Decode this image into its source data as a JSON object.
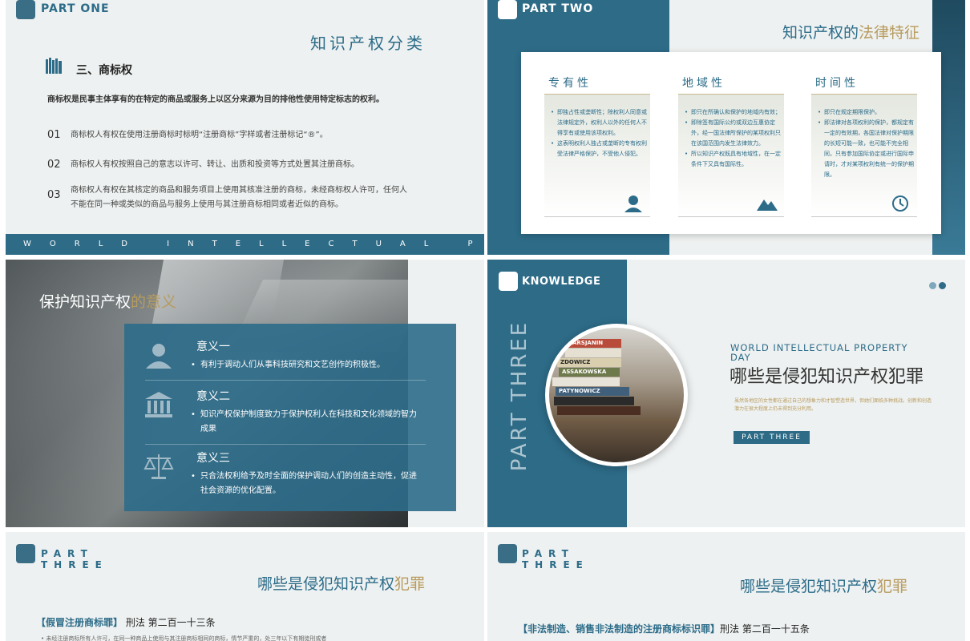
{
  "slide1": {
    "part": "PART ONE",
    "title": "知识产权分类",
    "subtitle": "三、商标权",
    "intro": "商标权是民事主体享有的在特定的商品或服务上以区分来源为目的排他性使用特定标志的权利。",
    "items": [
      {
        "num": "01",
        "text": "商标权人有权在使用注册商标时标明“注册商标”字样或者注册标记“®”。"
      },
      {
        "num": "02",
        "text": "商标权人有权按照自己的意志以许可、转让、出质和投资等方式处置其注册商标。"
      },
      {
        "num": "03",
        "text": "商标权人有权在其核定的商品和服务项目上使用其核准注册的商标，未经商标权人许可，任何人不能在同一种或类似的商品与服务上使用与其注册商标相同或者近似的商标。"
      }
    ],
    "banner": "WORLD INTELLECTUAL PROPERTY DAY"
  },
  "slide2": {
    "part": "PART TWO",
    "title_a": "知识产权的",
    "title_b": "法律特征",
    "columns": [
      {
        "heading": "专有性",
        "icon": "person-icon",
        "bullets": [
          "即独占性或垄断性；除权利人同意或法律规定外，权利人以外的任何人不得享有或使用该项权利。",
          "这表明权利人独占或垄断的专有权利受法律严格保护，不受他人侵犯。"
        ]
      },
      {
        "heading": "地域性",
        "icon": "mountain-icon",
        "bullets": [
          "即只在所确认和保护的地域内有效；",
          "即除签有国际公约或双边互惠协定外，经一国法律所保护的某项权利只在该国范围内发生法律效力。",
          "所以知识产权既具有地域性，在一定条件下又具有国际性。"
        ]
      },
      {
        "heading": "时间性",
        "icon": "clock-icon",
        "bullets": [
          "即只在规定期限保护。",
          "即法律对各项权利的保护，都规定有一定的有效期，各国法律对保护期限的长短可能一致，也可能不完全相同，只有参加国际协定或进行国际申请时，才对某项权利有统一的保护期限。"
        ]
      }
    ]
  },
  "slide3": {
    "title_a": "保护知识产权",
    "title_b": "的意义",
    "rows": [
      {
        "heading": "意义一",
        "text": "有利于调动人们从事科技研究和文艺创作的积极性。",
        "icon": "person-icon"
      },
      {
        "heading": "意义二",
        "text": "知识产权保护制度致力于保护权利人在科技和文化领域的智力成果",
        "icon": "building-icon"
      },
      {
        "heading": "意义三",
        "text": "只合法权利给予及时全面的保护调动人们的创造主动性，促进社会资源的优化配置。",
        "icon": "scales-icon"
      }
    ]
  },
  "slide4": {
    "label": "KNOWLEDGE",
    "vertical": "PART THREE",
    "en_title": "WORLD INTELLECTUAL PROPERTY DAY",
    "title": "哪些是侵犯知识产权犯罪",
    "desc": "虽然各地区的女性都在通过自己的想象力和才智塑造世界，但她们面临多种挑战。创新和创造潜力在很大程度上仍未得到充分利用。",
    "tag": "PART THREE",
    "books": [
      "MARSJANIN",
      "",
      "ZDOWICZ",
      "ASSAKOWSKA",
      "",
      "PATYNOWICZ",
      "",
      ""
    ],
    "dot_colors": [
      "#7fa8bb",
      "#2d6b87"
    ]
  },
  "slide5": {
    "pt1": "PART",
    "pt2": "THREE",
    "title_a": "哪些是侵犯知识产权",
    "title_b": "犯罪",
    "law_bold": "【假冒注册商标罪】",
    "law_rest": "刑法 第二百一十三条",
    "cut": "• 未经注册商标所有人许可，在同一种商品上使用与其注册商标相同的商标，情节严重的，处三年以下有期徒刑或者"
  },
  "slide6": {
    "pt1": "PART",
    "pt2": "THREE",
    "title_a": "哪些是侵犯知识产权",
    "title_b": "犯罪",
    "law_bold": "【非法制造、销售非法制造的注册商标标识罪】",
    "law_rest": "刑法 第二百一十五条"
  },
  "colors": {
    "teal": "#2d6b87",
    "gold": "#b89b5e",
    "bg": "#eef1f1"
  }
}
